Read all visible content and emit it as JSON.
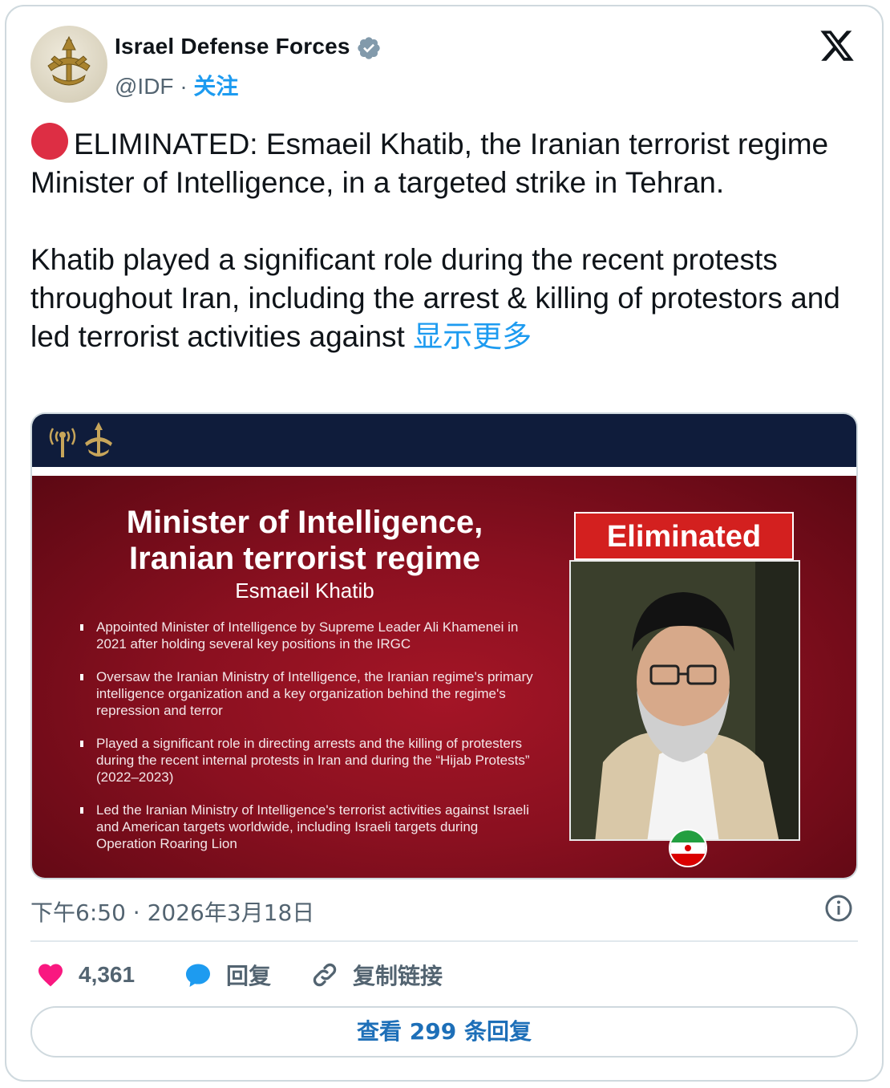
{
  "author": {
    "name": "Israel Defense Forces",
    "handle": "@IDF",
    "separator": "·",
    "follow_label": "关注"
  },
  "tweet": {
    "line1_text": "ELIMINATED: Esmaeil Khatib, the Iranian terrorist regime Minister of Intelligence, in a targeted strike in Tehran.",
    "line2_text": "Khatib played a significant role during the recent protests throughout Iran, including the arrest & killing of protestors and led terrorist activities against",
    "show_more": "显示更多"
  },
  "media": {
    "title": "Minister of Intelligence, Iranian terrorist regime",
    "subtitle": "Esmaeil Khatib",
    "badge": "Eliminated",
    "bullets": [
      "Appointed Minister of Intelligence by Supreme Leader Ali Khamenei in 2021 after holding several key positions in the IRGC",
      "Oversaw the Iranian Ministry of Intelligence, the Iranian regime's primary intelligence organization and a key organization behind the regime's repression and terror",
      "Played a significant role in directing arrests and the killing of protesters during the recent internal protests in Iran and during the “Hijab Protests” (2022–2023)",
      "Led the Iranian Ministry of Intelligence's terrorist activities against Israeli and American targets worldwide, including Israeli targets during Operation Roaring Lion"
    ]
  },
  "meta": {
    "timestamp": "下午6:50 · 2026年3月18日"
  },
  "actions": {
    "likes_count": "4,361",
    "reply_label": "回复",
    "copy_link_label": "复制链接"
  },
  "replies_button": "查看 299 条回复",
  "colors": {
    "accent": "#1d9bf0",
    "like": "#f91880",
    "media_header": "#0f1c3b",
    "media_bg": "#8a1020",
    "badge": "#d3201f"
  },
  "icons": [
    "idf-logo-icon",
    "verified-icon",
    "x-logo-icon",
    "red-circle-icon",
    "info-icon",
    "heart-icon",
    "reply-icon",
    "link-icon",
    "flag-icon"
  ]
}
